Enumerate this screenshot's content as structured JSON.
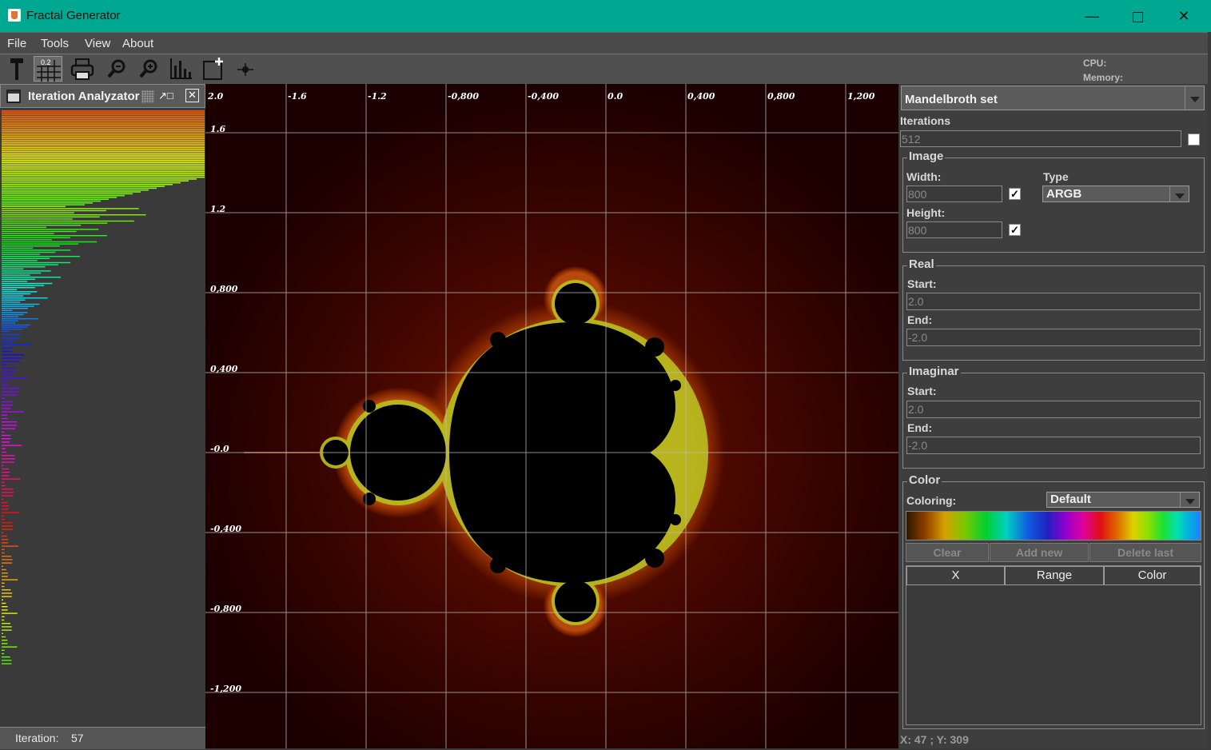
{
  "window": {
    "title": "Fractal Generator",
    "minimize_icon": "minimize-icon",
    "maximize_icon": "maximize-icon",
    "close_icon": "close-icon"
  },
  "menu": [
    "File",
    "Tools",
    "View",
    "About"
  ],
  "toolbar": {
    "buttons": [
      {
        "name": "hammer-icon"
      },
      {
        "name": "grid-icon",
        "label": "0.2",
        "active": true
      },
      {
        "name": "print-icon"
      },
      {
        "name": "zoom-out-icon"
      },
      {
        "name": "zoom-in-icon"
      },
      {
        "name": "histogram-icon"
      },
      {
        "name": "new-window-icon"
      },
      {
        "name": "crosshair-icon"
      }
    ],
    "cpu_label": "CPU:",
    "memory_label": "Memory:"
  },
  "iteration_analyzer": {
    "title": "Iteration Analyzator",
    "footer_label": "Iteration:",
    "footer_value": "57"
  },
  "fractal_view": {
    "x_ticks": [
      "2.0",
      "-1.6",
      "-1.2",
      "-0,800",
      "-0,400",
      "0.0",
      "0,400",
      "0,800",
      "1,200"
    ],
    "y_ticks": [
      "1.6",
      "1.2",
      "0,800",
      "0,400",
      "-0.0",
      "-0,400",
      "-0,800",
      "-1,200"
    ]
  },
  "settings": {
    "fractal_type": "Mandelbroth set",
    "iterations_label": "Iterations",
    "iterations_value": "512",
    "image": {
      "title": "Image",
      "width_label": "Width:",
      "width_value": "800",
      "height_label": "Height:",
      "height_value": "800",
      "type_label": "Type",
      "type_value": "ARGB",
      "check_mark": "✓"
    },
    "real": {
      "title": "Real",
      "start_label": "Start:",
      "start_value": "2.0",
      "end_label": "End:",
      "end_value": "-2.0"
    },
    "imaginar": {
      "title": "Imaginar",
      "start_label": "Start:",
      "start_value": "2.0",
      "end_label": "End:",
      "end_value": "-2.0"
    },
    "color": {
      "title": "Color",
      "coloring_label": "Coloring:",
      "coloring_value": "Default",
      "clear_label": "Clear",
      "add_new_label": "Add new",
      "delete_last_label": "Delete last",
      "table_headers": [
        "X",
        "Range",
        "Color"
      ]
    }
  },
  "status": {
    "coords": "X: 47 ; Y: 309"
  },
  "colors": {
    "titlebar": "#00a891",
    "panel": "#3e3e3e",
    "fractal_bg": "#1e0000"
  }
}
